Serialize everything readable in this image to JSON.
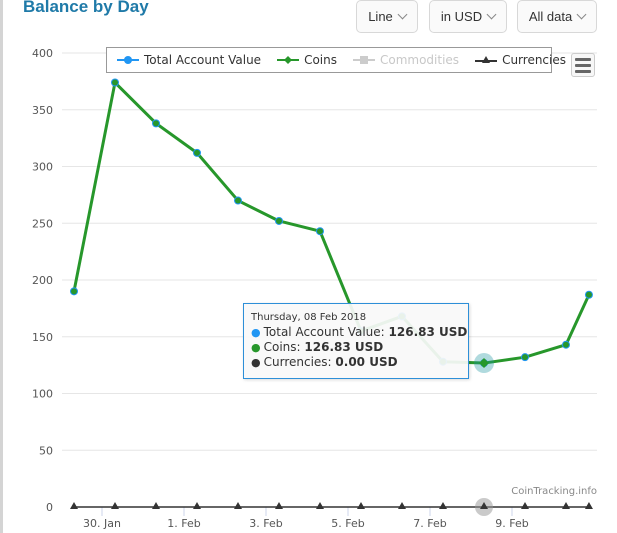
{
  "header": {
    "title": "Balance by Day",
    "dropdowns": [
      {
        "label": "Line"
      },
      {
        "label": "in USD"
      },
      {
        "label": "All data"
      }
    ]
  },
  "legend": {
    "items": [
      {
        "label": "Total Account Value",
        "color": "#2196f3",
        "symbol": "circle",
        "enabled": true
      },
      {
        "label": "Coins",
        "color": "#27972b",
        "symbol": "diamond",
        "enabled": true
      },
      {
        "label": "Commodities",
        "color": "#cccccc",
        "symbol": "square",
        "enabled": false
      },
      {
        "label": "Currencies",
        "color": "#333333",
        "symbol": "triangle",
        "enabled": true
      }
    ]
  },
  "tooltip": {
    "date": "Thursday, 08 Feb 2018",
    "rows": [
      {
        "name": "Total Account Value:",
        "value": "126.83 USD",
        "color": "#2196f3"
      },
      {
        "name": "Coins:",
        "value": "126.83 USD",
        "color": "#27972b"
      },
      {
        "name": "Currencies:",
        "value": "0.00 USD",
        "color": "#333333"
      }
    ]
  },
  "credit": "CoinTracking.info",
  "chart_data": {
    "type": "line",
    "title": "Balance by Day",
    "xlabel": "",
    "ylabel": "",
    "ylim": [
      0,
      400
    ],
    "yticks": [
      0,
      50,
      100,
      150,
      200,
      250,
      300,
      350,
      400
    ],
    "xtick_labels": [
      "30. Jan",
      "1. Feb",
      "3. Feb",
      "5. Feb",
      "7. Feb",
      "9. Feb"
    ],
    "xtick_days": [
      1,
      3,
      5,
      7,
      9,
      11
    ],
    "x": [
      "29 Jan",
      "30 Jan",
      "31 Jan",
      "1 Feb",
      "2 Feb",
      "3 Feb",
      "4 Feb",
      "5 Feb",
      "6 Feb",
      "7 Feb",
      "8 Feb",
      "9 Feb",
      "10 Feb",
      "11 Feb"
    ],
    "x_days": [
      0,
      1,
      2,
      3,
      4,
      5,
      6,
      7,
      8,
      9,
      10,
      11,
      12,
      12.56
    ],
    "grid": true,
    "legend_position": "top",
    "highlighted_index": 10,
    "series": [
      {
        "name": "Total Account Value",
        "color": "#2196f3",
        "values": [
          190,
          374,
          338,
          312,
          270,
          252,
          243,
          155,
          168,
          128,
          126.83,
          132,
          143,
          187
        ]
      },
      {
        "name": "Coins",
        "color": "#27972b",
        "values": [
          190,
          374,
          338,
          312,
          270,
          252,
          243,
          155,
          168,
          128,
          126.83,
          132,
          143,
          187
        ]
      },
      {
        "name": "Currencies",
        "color": "#333333",
        "values": [
          0,
          0,
          0,
          0,
          0,
          0,
          0,
          0,
          0,
          0,
          0,
          0,
          0,
          0
        ]
      }
    ]
  }
}
